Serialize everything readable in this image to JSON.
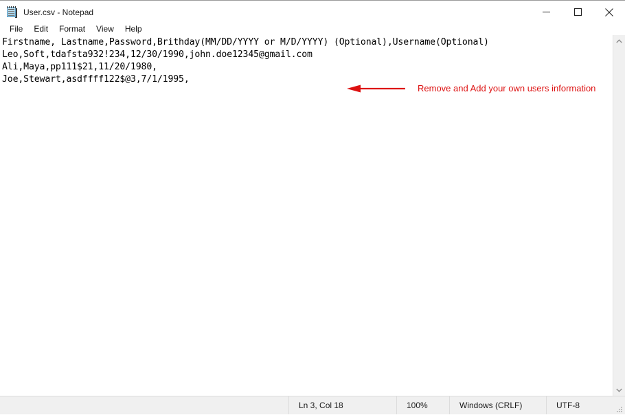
{
  "window": {
    "title": "User.csv - Notepad",
    "icon": "notepad-icon",
    "controls": {
      "minimize": "minimize-icon",
      "maximize": "maximize-icon",
      "close": "close-icon"
    }
  },
  "menubar": {
    "items": [
      {
        "label": "File"
      },
      {
        "label": "Edit"
      },
      {
        "label": "Format"
      },
      {
        "label": "View"
      },
      {
        "label": "Help"
      }
    ]
  },
  "editor": {
    "lines": [
      "Firstname, Lastname,Password,Brithday(MM/DD/YYYY or M/D/YYYY) (Optional),Username(Optional)",
      "Leo,Soft,tdafsta932!234,12/30/1990,john.doe12345@gmail.com",
      "Ali,Maya,pp111$21,11/20/1980,",
      "Joe,Stewart,asdffff122$@3,7/1/1995,"
    ]
  },
  "annotation": {
    "text": "Remove and Add your own users information",
    "color": "#dd1111",
    "arrow_direction": "left"
  },
  "scrollbar": {
    "up_arrow": "chevron-up-icon",
    "down_arrow": "chevron-down-icon"
  },
  "statusbar": {
    "position": "Ln 3, Col 18",
    "zoom": "100%",
    "line_ending": "Windows (CRLF)",
    "encoding": "UTF-8"
  }
}
